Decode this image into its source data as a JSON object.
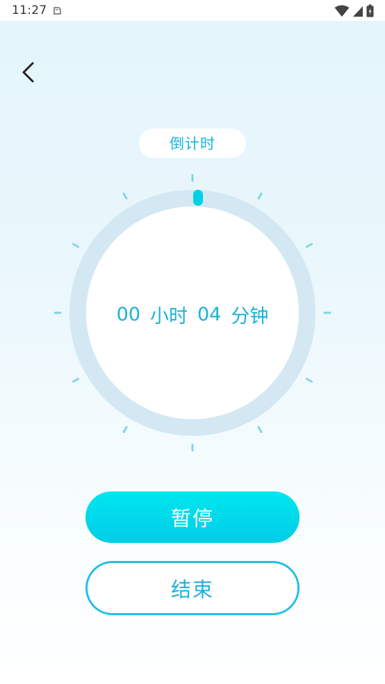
{
  "status_bar": {
    "time": "11:27",
    "icons": [
      "notification-icon",
      "wifi-icon",
      "signal-icon",
      "battery-icon"
    ]
  },
  "nav": {
    "back_icon": "chevron-left-icon"
  },
  "mode": {
    "label": "倒计时"
  },
  "timer": {
    "hours": "00",
    "hours_unit": "小时",
    "minutes": "04",
    "minutes_unit": "分钟",
    "remaining_minutes": 4,
    "progress_fraction": 0.0
  },
  "actions": {
    "pause_label": "暂停",
    "end_label": "结束"
  },
  "colors": {
    "accent": "#19b3d4",
    "ring_track": "#d3e8f2",
    "tick": "#7fd6e6",
    "knob": "#00d2e6",
    "pause_button": "#00d9ea",
    "end_border": "#23bde8"
  }
}
